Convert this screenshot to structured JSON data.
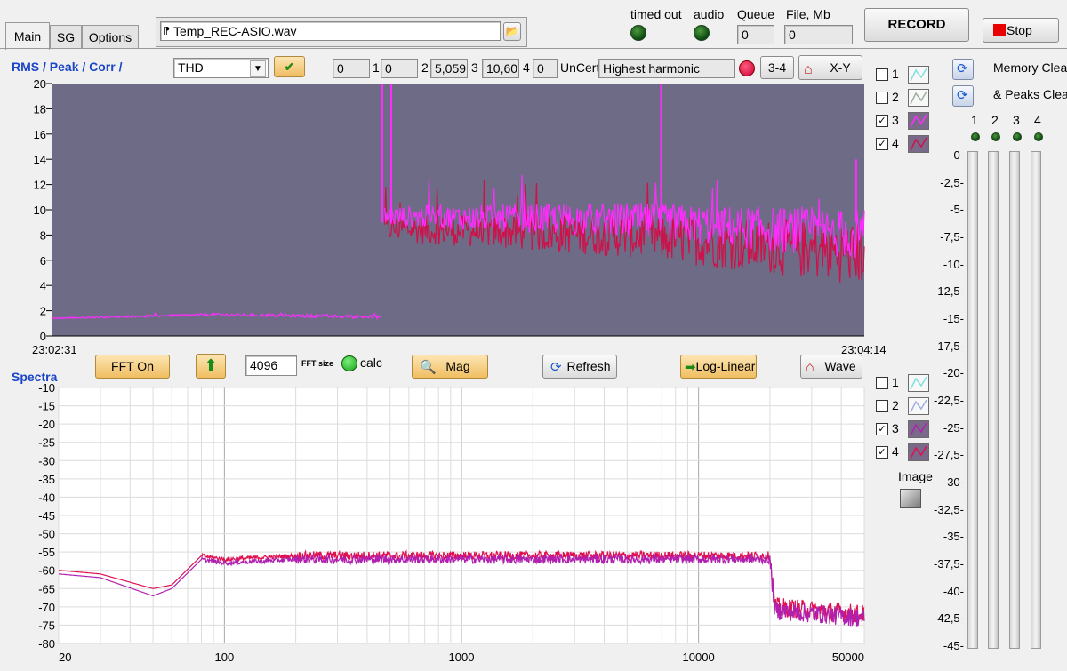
{
  "tabs": [
    "Main",
    "SG",
    "Options"
  ],
  "file": {
    "name": "Temp_REC-ASIO.wav"
  },
  "status": {
    "timed_out_label": "timed out",
    "audio_label": "audio",
    "queue_label": "Queue",
    "queue_value": "0",
    "file_mb_label": "File, Mb",
    "file_mb_value": "0"
  },
  "buttons": {
    "record": "RECORD",
    "stop": "Stop",
    "three_four": "3-4",
    "xy": "X-Y",
    "fft_on": "FFT On",
    "mag": "Mag",
    "refresh": "Refresh",
    "log_linear": "Log-Linear",
    "wave": "Wave",
    "image": "Image"
  },
  "clear": {
    "memory": "Memory Clear",
    "peaks": "& Peaks Clear"
  },
  "upper": {
    "title": "RMS / Peak / Corr /",
    "measure_select": "THD",
    "fields": [
      {
        "value": "0",
        "label": "1"
      },
      {
        "value": "0",
        "label": "2"
      },
      {
        "value": "5,059",
        "label": "3"
      },
      {
        "value": "10,60",
        "label": "4"
      },
      {
        "value": "0",
        "label": ""
      }
    ],
    "uncert_label": "UnCert",
    "uncert_value": "Highest harmonic",
    "channels": [
      {
        "label": "1",
        "checked": false,
        "color": "#7fe0e0"
      },
      {
        "label": "2",
        "checked": false,
        "color": "#9ab0a0"
      },
      {
        "label": "3",
        "checked": true,
        "color": "#ff2cff"
      },
      {
        "label": "4",
        "checked": true,
        "color": "#d0104a"
      }
    ]
  },
  "fft": {
    "size_value": "4096",
    "size_label": "FFT size",
    "calc_label": "calc"
  },
  "lower": {
    "title": "Spectra",
    "channels": [
      {
        "label": "1",
        "checked": false,
        "color": "#7fe0e0"
      },
      {
        "label": "2",
        "checked": false,
        "color": "#a0b0e0"
      },
      {
        "label": "3",
        "checked": true,
        "color": "#b020b0"
      },
      {
        "label": "4",
        "checked": true,
        "color": "#e01050"
      }
    ]
  },
  "meter": {
    "channels": [
      "1",
      "2",
      "3",
      "4"
    ],
    "ticks": [
      "0",
      "-2,5",
      "-5",
      "-7,5",
      "-10",
      "-12,5",
      "-15",
      "-17,5",
      "-20",
      "-22,5",
      "-25",
      "-27,5",
      "-30",
      "-32,5",
      "-35",
      "-37,5",
      "-40",
      "-42,5",
      "-45"
    ]
  },
  "chart_data": [
    {
      "type": "line",
      "title": "RMS / Peak / Corr /",
      "x_start_label": "23:02:31",
      "x_end_label": "23:04:14",
      "ylim": [
        0,
        20
      ],
      "yticks": [
        0,
        2,
        4,
        6,
        8,
        10,
        12,
        14,
        16,
        18,
        20
      ],
      "background": "#6d6b85",
      "series": [
        {
          "color": "#ff2cff",
          "segments": [
            {
              "t": [
                0,
                0.405
              ],
              "y": [
                1.4,
                1.7,
                1.5
              ],
              "noise": 0.15
            },
            {
              "t": [
                0.41,
                1.0
              ],
              "y": [
                9.5,
                9.2,
                8.0
              ],
              "noise": 2.0
            }
          ],
          "spikes": [
            [
              0.407,
              20
            ],
            [
              0.418,
              20
            ],
            [
              0.75,
              20
            ],
            [
              0.99,
              14
            ]
          ]
        },
        {
          "color": "#d0104a",
          "segments": [
            {
              "t": [
                0.41,
                1.0
              ],
              "y": [
                8.5,
                8.0,
                6.5
              ],
              "noise": 2.5
            }
          ]
        }
      ]
    },
    {
      "type": "line",
      "title": "Spectra",
      "xscale": "log",
      "xlim": [
        20,
        50000
      ],
      "xticks": [
        20,
        100,
        1000,
        10000,
        50000
      ],
      "ylim": [
        -80,
        -10
      ],
      "yticks": [
        -10,
        -15,
        -20,
        -25,
        -30,
        -35,
        -40,
        -45,
        -50,
        -55,
        -60,
        -65,
        -70,
        -75,
        -80
      ],
      "grid": true,
      "series": [
        {
          "color": "#e01050",
          "points": [
            [
              20,
              -60
            ],
            [
              30,
              -61
            ],
            [
              50,
              -65
            ],
            [
              60,
              -64
            ],
            [
              80,
              -56
            ],
            [
              100,
              -57
            ],
            [
              200,
              -56
            ],
            [
              1000,
              -56
            ],
            [
              10000,
              -56
            ],
            [
              20000,
              -56
            ],
            [
              21000,
              -70
            ],
            [
              50000,
              -72
            ]
          ]
        },
        {
          "color": "#b020b0",
          "points": [
            [
              20,
              -61
            ],
            [
              30,
              -62
            ],
            [
              50,
              -67
            ],
            [
              60,
              -65
            ],
            [
              80,
              -57
            ],
            [
              100,
              -58
            ],
            [
              200,
              -57
            ],
            [
              1000,
              -57
            ],
            [
              10000,
              -57
            ],
            [
              20000,
              -57
            ],
            [
              21000,
              -71
            ],
            [
              50000,
              -73
            ]
          ]
        }
      ]
    }
  ]
}
